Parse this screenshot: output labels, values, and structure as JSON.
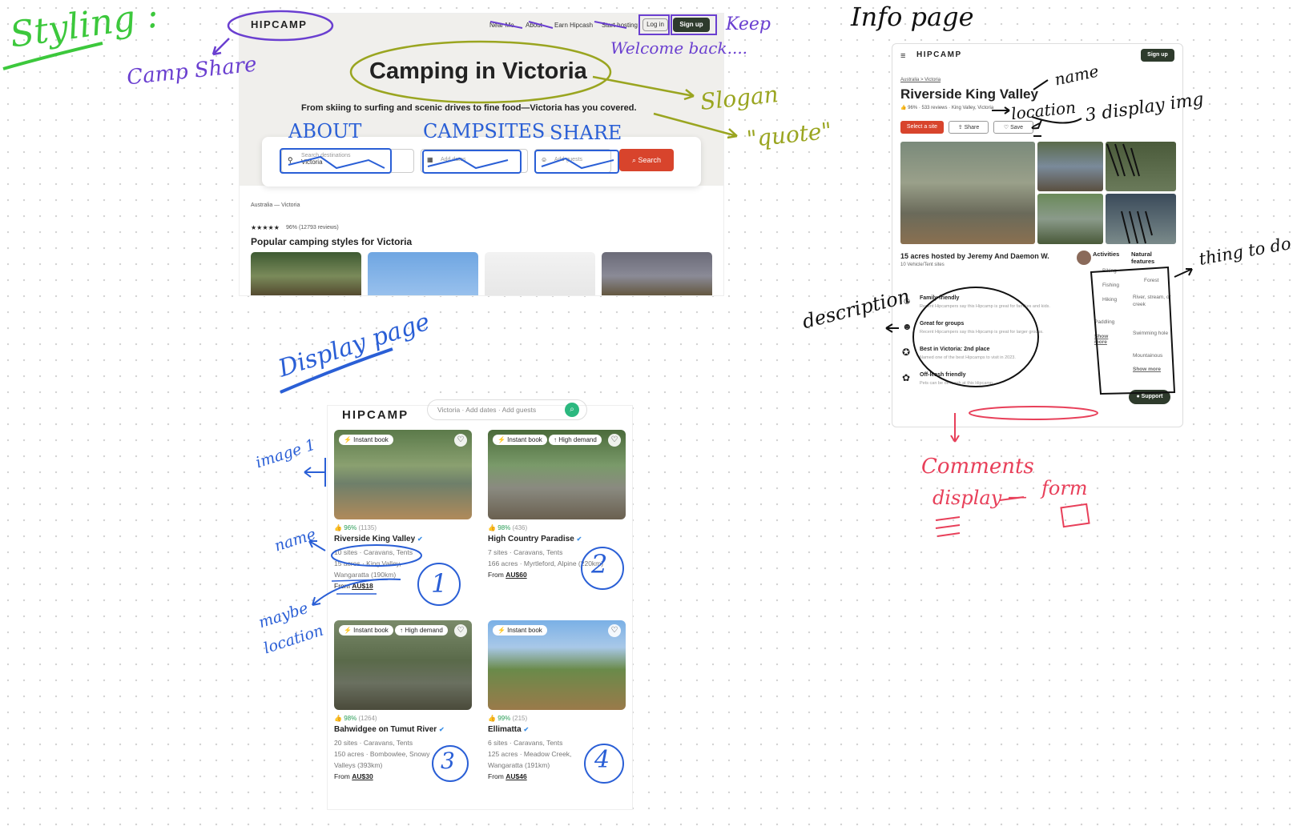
{
  "annotations": {
    "styling": "Styling :",
    "camp_share": "Camp Share",
    "keep": "Keep",
    "welcome_back": "Welcome back....",
    "slogan": "Slogan",
    "quote": "\"quote\"",
    "about": "ABOUT",
    "campsites": "CAMPSITES",
    "share": "SHARE",
    "display_page": "Display page",
    "image_1": "image 1",
    "name_left": "name",
    "maybe": "maybe",
    "location_left": "location",
    "num_1": "1",
    "num_2": "2",
    "num_3": "3",
    "num_4": "4",
    "info_page": "Info page",
    "name_right": "name",
    "location_right": "location",
    "display_img": "3 display img",
    "thing_to_do": "thing to do",
    "description": "description",
    "comments": "Comments",
    "display": "display",
    "dash": "—",
    "form": "form"
  },
  "landing": {
    "logo": "HIPCAMP",
    "nav": [
      "Near Me",
      "About",
      "Earn Hipcash",
      "Start hosting"
    ],
    "login": "Log in",
    "signup": "Sign up",
    "title": "Camping in Victoria",
    "subtitle": "From skiing to surfing and scenic drives to fine food—Victoria has you covered.",
    "search": {
      "dest_label": "Search destinations",
      "dest_value": "Victoria",
      "dates": "Add dates",
      "guests": "Add guests",
      "button": "Search"
    },
    "breadcrumb": "Australia — Victoria",
    "rating": "★★★★★",
    "rating_text": "96% (12793 reviews)",
    "section_title": "Popular camping styles for Victoria"
  },
  "display": {
    "logo": "HIPCAMP",
    "search_text": "Victoria · Add dates · Add guests",
    "cards": [
      {
        "badges": [
          "⚡ Instant book"
        ],
        "pct": "96%",
        "count": "(1135)",
        "name": "Riverside King Valley",
        "meta1": "10 sites · Caravans, Tents",
        "meta2": "15 acres · King Valley,",
        "meta3": "Wangaratta (190km)",
        "from": "From",
        "price": "AU$18"
      },
      {
        "badges": [
          "⚡ Instant book",
          "↑ High demand"
        ],
        "pct": "98%",
        "count": "(436)",
        "name": "High Country Paradise",
        "meta1": "7 sites · Caravans, Tents",
        "meta2": "166 acres · Myrtleford, Alpine (220km)",
        "meta3": "",
        "from": "From",
        "price": "AU$60"
      },
      {
        "badges": [
          "⚡ Instant book",
          "↑ High demand"
        ],
        "pct": "98%",
        "count": "(1264)",
        "name": "Bahwidgee on Tumut River",
        "meta1": "20 sites · Caravans, Tents",
        "meta2": "150 acres · Bombowlee, Snowy",
        "meta3": "Valleys (393km)",
        "from": "From",
        "price": "AU$30"
      },
      {
        "badges": [
          "⚡ Instant book"
        ],
        "pct": "99%",
        "count": "(215)",
        "name": "Ellimatta",
        "meta1": "6 sites · Caravans, Tents",
        "meta2": "125 acres · Meadow Creek,",
        "meta3": "Wangaratta (191km)",
        "from": "From",
        "price": "AU$46"
      }
    ]
  },
  "info": {
    "logo": "HIPCAMP",
    "signup": "Sign up",
    "breadcrumb": "Australia > Victoria",
    "title": "Riverside King Valley",
    "sub": "👍 96% · 533 reviews · King Valley, Victoria",
    "select_site": "Select a site",
    "share": "Share",
    "save": "Save",
    "host_title": "15 acres hosted by Jeremy And Daemon W.",
    "host_sub": "10 Vehicle/Tent sites",
    "features": [
      {
        "title": "Family friendly",
        "desc": "Recent Hipcampers say this Hipcamp is great for families and kids."
      },
      {
        "title": "Great for groups",
        "desc": "Recent Hipcampers say this Hipcamp is great for larger groups."
      },
      {
        "title": "Best in Victoria: 2nd place",
        "desc": "Named one of the best Hipcamps to visit in 2023."
      },
      {
        "title": "Off-leash friendly",
        "desc": "Pets can be off-leash at this Hipcamp."
      }
    ],
    "activities_title": "Activities",
    "activities": [
      "Biking",
      "Fishing",
      "Hiking",
      "Paddling"
    ],
    "show_more_1": "Show more",
    "natural_title": "Natural features",
    "natural": [
      "Forest",
      "River, stream, or creek",
      "Swimming hole",
      "Mountainous"
    ],
    "show_more_2": "Show more",
    "support": "Support"
  },
  "colors": {
    "brand_red": "#d8442c",
    "brand_dark": "#2e3b2c",
    "ann_purple": "#6a3fd0",
    "ann_olive": "#9aa520",
    "ann_blue": "#2a5fd6",
    "ann_green": "#3cc83c",
    "ann_red": "#e8405a"
  }
}
